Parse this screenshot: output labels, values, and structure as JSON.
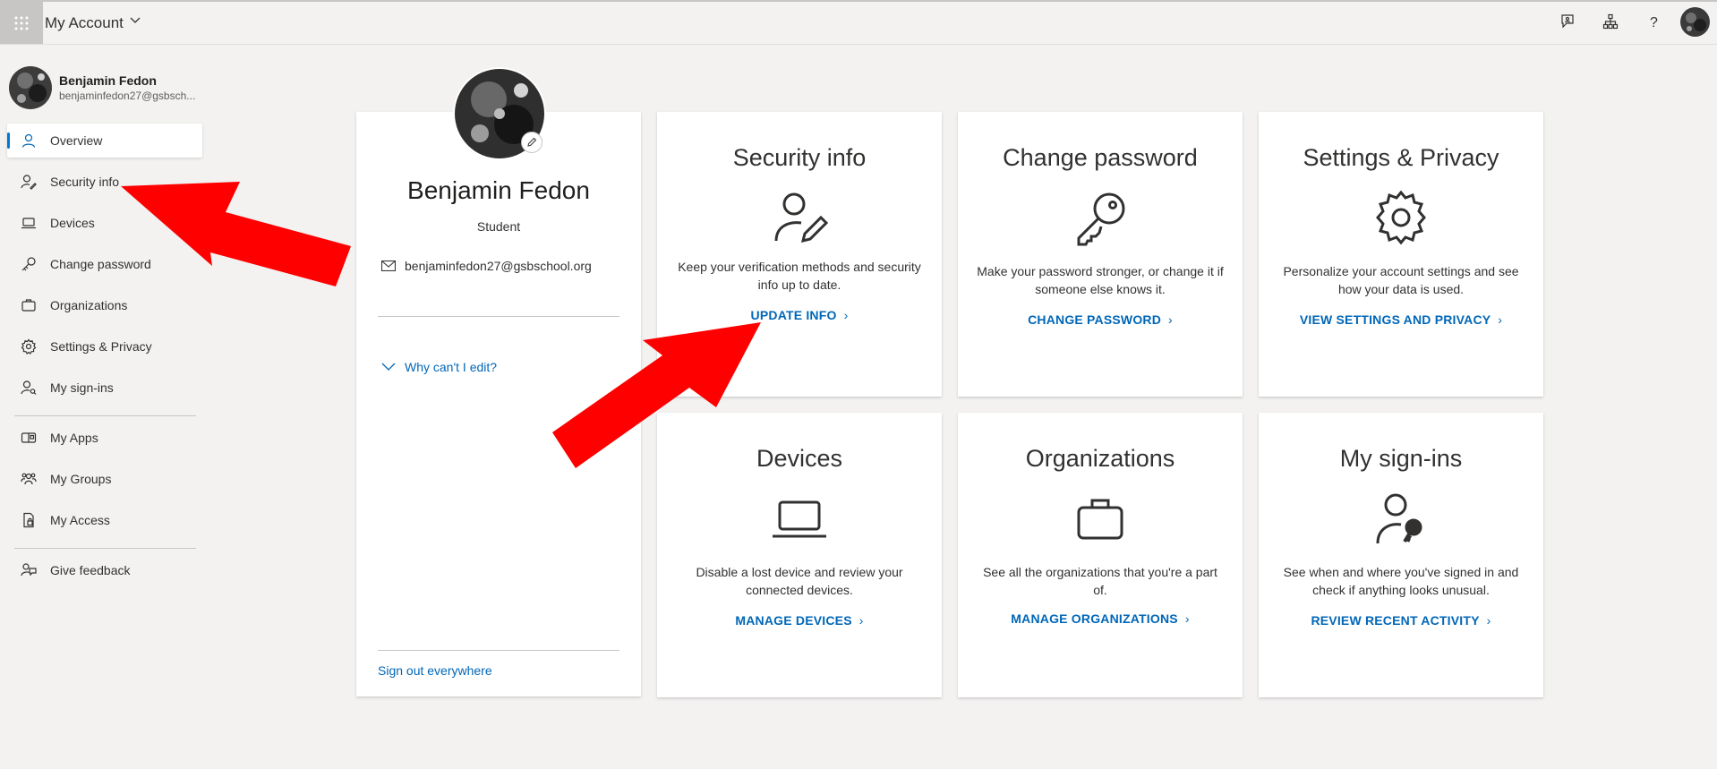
{
  "header": {
    "app_title": "My Account",
    "icons": [
      "app-launcher-icon",
      "chevron-down-icon",
      "feedback-icon",
      "organization-icon",
      "help-icon",
      "avatar"
    ]
  },
  "sidebar": {
    "user": {
      "name": "Benjamin Fedon",
      "email": "benjaminfedon27@gsbsch..."
    },
    "items": [
      {
        "label": "Overview",
        "icon": "person-icon",
        "active": true
      },
      {
        "label": "Security info",
        "icon": "person-key-icon"
      },
      {
        "label": "Devices",
        "icon": "laptop-icon"
      },
      {
        "label": "Change password",
        "icon": "key-icon"
      },
      {
        "label": "Organizations",
        "icon": "briefcase-icon"
      },
      {
        "label": "Settings & Privacy",
        "icon": "gear-icon"
      },
      {
        "label": "My sign-ins",
        "icon": "person-signin-icon"
      },
      {
        "label": "My Apps",
        "icon": "apps-icon"
      },
      {
        "label": "My Groups",
        "icon": "groups-icon"
      },
      {
        "label": "My Access",
        "icon": "access-icon"
      },
      {
        "label": "Give feedback",
        "icon": "feedback-icon"
      }
    ]
  },
  "profile": {
    "name": "Benjamin Fedon",
    "role": "Student",
    "email": "benjaminfedon27@gsbschool.org",
    "why_cant_edit": "Why can't I edit?",
    "sign_out": "Sign out everywhere"
  },
  "tiles": [
    {
      "title": "Security info",
      "desc": "Keep your verification methods and security info up to date.",
      "link": "UPDATE INFO",
      "icon": "person-edit-icon"
    },
    {
      "title": "Change password",
      "desc": "Make your password stronger, or change it if someone else knows it.",
      "link": "CHANGE PASSWORD",
      "icon": "key-icon"
    },
    {
      "title": "Settings & Privacy",
      "desc": "Personalize your account settings and see how your data is used.",
      "link": "VIEW SETTINGS AND PRIVACY",
      "icon": "gear-icon"
    },
    {
      "title": "Devices",
      "desc": "Disable a lost device and review your connected devices.",
      "link": "MANAGE DEVICES",
      "icon": "laptop-icon"
    },
    {
      "title": "Organizations",
      "desc": "See all the organizations that you're a part of.",
      "link": "MANAGE ORGANIZATIONS",
      "icon": "briefcase-icon"
    },
    {
      "title": "My sign-ins",
      "desc": "See when and where you've signed in and check if anything looks unusual.",
      "link": "REVIEW RECENT ACTIVITY",
      "icon": "person-key-icon"
    }
  ],
  "colors": {
    "accent": "#0067b8",
    "annotation_arrow": "#ff0000",
    "background": "#f3f2f1"
  }
}
